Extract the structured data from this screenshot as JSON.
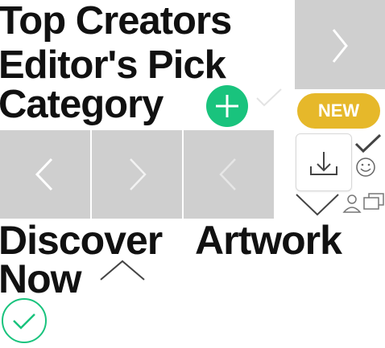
{
  "headings": {
    "top_creators": "Top Creators",
    "editors_pick": "Editor's Pick",
    "category": "Category",
    "discover": "Discover",
    "artwork": "Artwork",
    "now": "Now"
  },
  "badge": {
    "label": "NEW"
  },
  "colors": {
    "text": "#111111",
    "tile": "#cfcfcf",
    "accent_green": "#19c37d",
    "badge_yellow": "#e6b82a",
    "icon_gray": "#555555"
  },
  "icons": [
    "chevron-right-icon",
    "plus-circle-icon",
    "check-light-icon",
    "chevron-left-icon",
    "check-icon",
    "download-icon",
    "smiley-icon",
    "chevron-down-icon",
    "user-icon",
    "windows-icon",
    "chevron-up-icon",
    "check-circle-icon"
  ]
}
